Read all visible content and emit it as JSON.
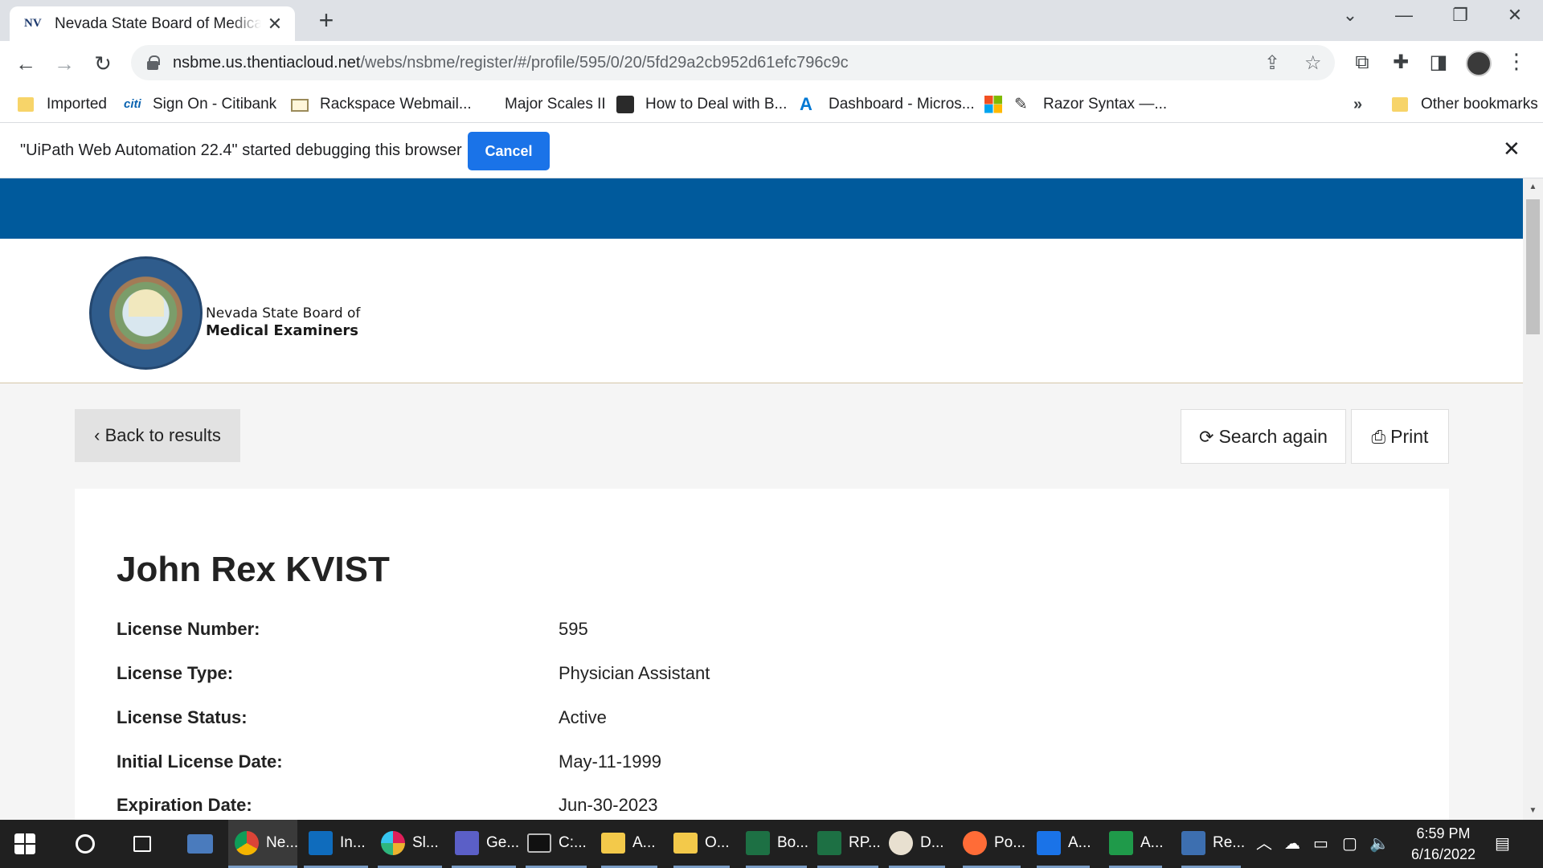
{
  "browser": {
    "tab": {
      "favicon_text": "NV",
      "title": "Nevada State Board of Medical Examiners"
    },
    "url": {
      "host": "nsbme.us.thentiacloud.net",
      "path": "/webs/nsbme/register/#/profile/595/0/20/5fd29a2cb952d61efc796c9c"
    },
    "bookmarks": [
      {
        "label": "Imported",
        "icon": "folder-icon"
      },
      {
        "label": "Sign On - Citibank",
        "icon": "citi-icon"
      },
      {
        "label": "Rackspace Webmail...",
        "icon": "mail-icon"
      },
      {
        "label": "Major Scales II",
        "icon": "blank-page-icon"
      },
      {
        "label": "How to Deal with B...",
        "icon": "book-icon"
      },
      {
        "label": "Dashboard - Micros...",
        "icon": "azure-icon"
      },
      {
        "label": "",
        "icon": "microsoft-icon"
      },
      {
        "label": "Razor Syntax —...",
        "icon": "pen-icon"
      }
    ],
    "bookmarks_overflow": "»",
    "other_bookmarks": "Other bookmarks"
  },
  "infobar": {
    "message": "\"UiPath Web Automation 22.4\" started debugging this browser",
    "cancel_label": "Cancel",
    "close_glyph": "✕"
  },
  "site": {
    "org_line1": "Nevada State Board of",
    "org_line2": "Medical Examiners",
    "colors": {
      "band": "#005a9c",
      "header_border": "#d4c6a8"
    }
  },
  "actions": {
    "back": "‹ Back to results",
    "search_again": "Search again",
    "print": "Print"
  },
  "profile": {
    "name": "John Rex KVIST",
    "fields": [
      {
        "label": "License Number:",
        "value": "595"
      },
      {
        "label": "License Type:",
        "value": "Physician Assistant"
      },
      {
        "label": "License Status:",
        "value": "Active"
      },
      {
        "label": "Initial License Date:",
        "value": "May-11-1999"
      },
      {
        "label": "Expiration Date:",
        "value": "Jun-30-2023"
      }
    ]
  },
  "taskbar": {
    "items": [
      {
        "label": "Ne...",
        "icon": "chrome-icon"
      },
      {
        "label": "In...",
        "icon": "outlook-icon"
      },
      {
        "label": "Sl...",
        "icon": "slack-icon"
      },
      {
        "label": "Ge...",
        "icon": "teams-icon"
      },
      {
        "label": "C:...",
        "icon": "terminal-icon"
      },
      {
        "label": "A...",
        "icon": "folder-icon"
      },
      {
        "label": "O...",
        "icon": "folder-icon"
      },
      {
        "label": "Bo...",
        "icon": "excel-icon"
      },
      {
        "label": "RP...",
        "icon": "excel-icon"
      },
      {
        "label": "D...",
        "icon": "dbeaver-icon"
      },
      {
        "label": "Po...",
        "icon": "postman-icon"
      },
      {
        "label": "A...",
        "icon": "sharepoint-icon"
      },
      {
        "label": "A...",
        "icon": "player-icon"
      },
      {
        "label": "Re...",
        "icon": "remote-desktop-icon"
      }
    ],
    "time": "6:59 PM",
    "date": "6/16/2022"
  }
}
